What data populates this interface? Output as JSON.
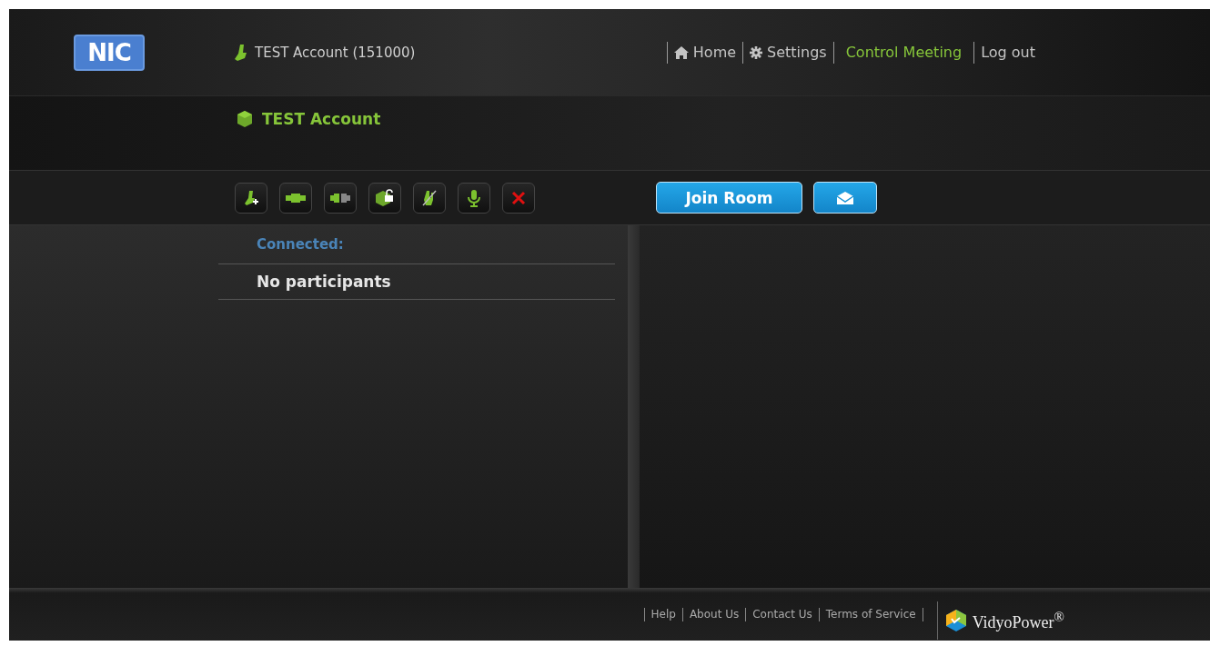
{
  "logo": {
    "text": "NIC"
  },
  "user": {
    "label": "TEST Account (151000)"
  },
  "nav": [
    {
      "label": "Home",
      "selected": false
    },
    {
      "label": "Settings",
      "selected": false
    },
    {
      "label": "Control Meeting",
      "selected": true
    },
    {
      "label": "Log out",
      "selected": false
    }
  ],
  "room": {
    "title": "TEST Account"
  },
  "toolbar": [
    {
      "kind": "add-person"
    },
    {
      "kind": "connect"
    },
    {
      "kind": "disconnect"
    },
    {
      "kind": "unlock"
    },
    {
      "kind": "mute-video"
    },
    {
      "kind": "mic"
    },
    {
      "kind": "remove"
    }
  ],
  "actions": {
    "join_label": "Join Room"
  },
  "participants": {
    "heading": "Connected:",
    "empty": "No participants"
  },
  "footer": {
    "links": [
      "Help",
      "About Us",
      "Contact Us",
      "Terms of Service"
    ],
    "brand": "VidyoPower$^{®}$"
  }
}
